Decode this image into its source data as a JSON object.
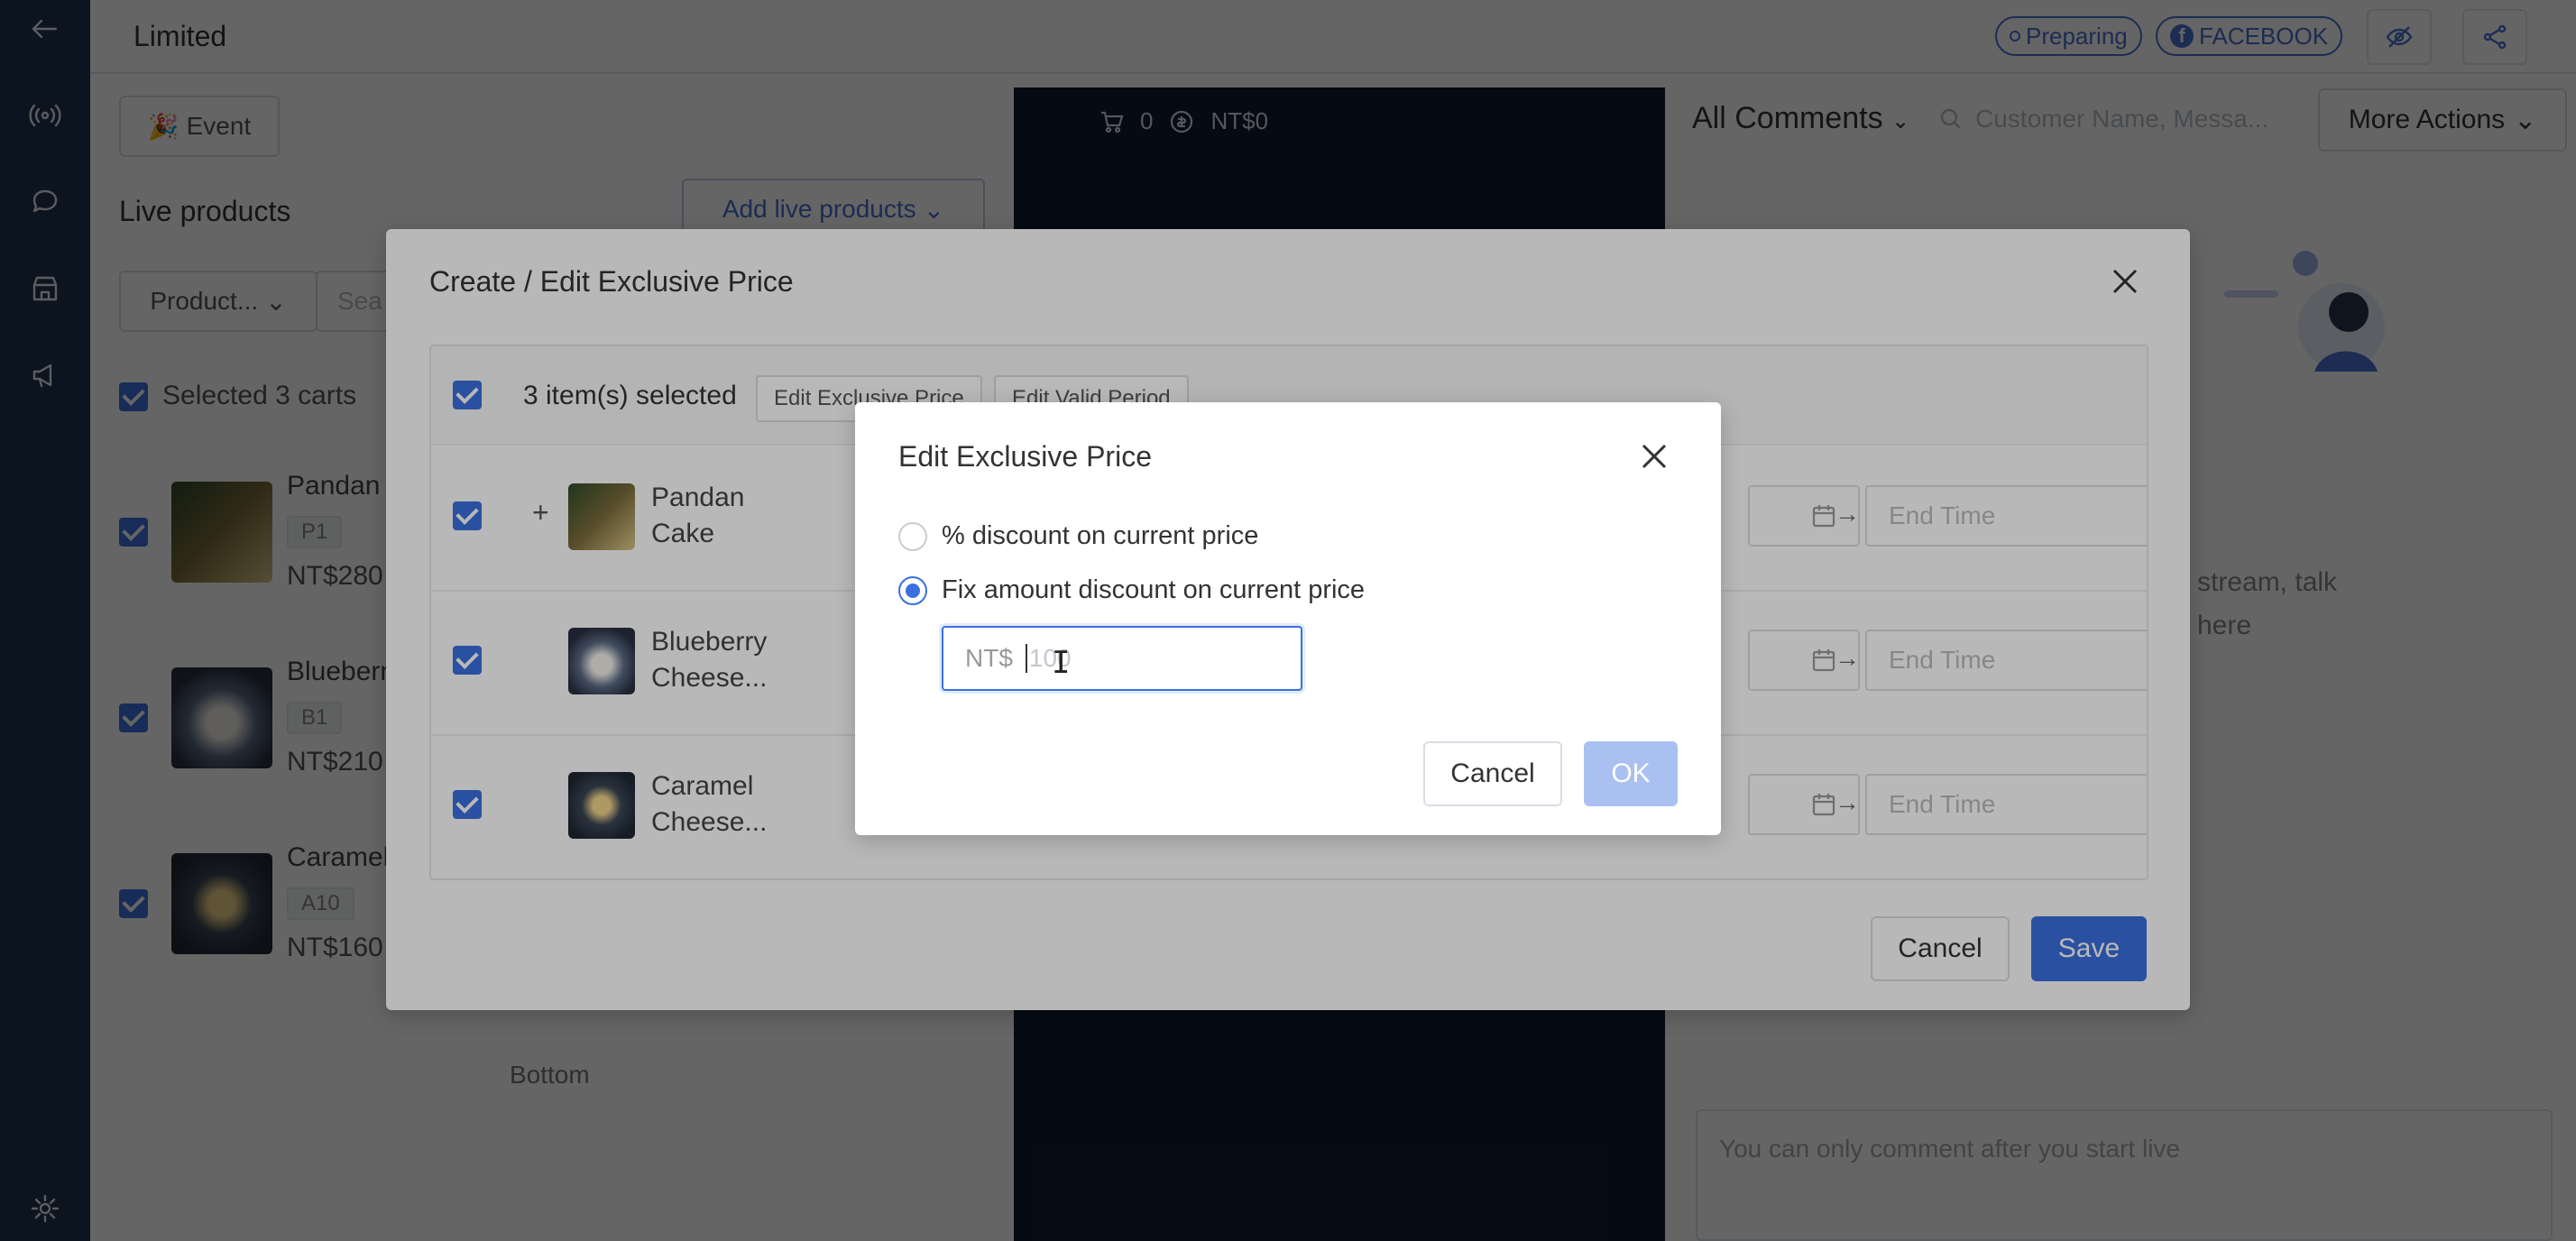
{
  "topbar": {
    "title": "Limited",
    "status_pill": "Preparing",
    "platform_pill": "FACEBOOK"
  },
  "sidebar": {
    "icons": [
      "back-arrow-icon",
      "broadcast-icon",
      "chat-icon",
      "store-icon",
      "megaphone-icon",
      "gear-icon"
    ]
  },
  "left_panel": {
    "event_button": "Event",
    "live_products_title": "Live products",
    "add_live_products": "Add live products",
    "product_filter": "Product...",
    "search_placeholder": "Sea",
    "selected_carts": "Selected 3 carts",
    "products": [
      {
        "name": "Pandan",
        "tag": "P1",
        "price": "NT$280"
      },
      {
        "name": "Bluebern",
        "tag": "B1",
        "price": "NT$210"
      },
      {
        "name": "Caramel",
        "tag": "A10",
        "price": "NT$160"
      }
    ],
    "bottom_text": "Bottom"
  },
  "stream": {
    "cart_count": "0",
    "amount": "NT$0"
  },
  "right_panel": {
    "comments_filter": "All Comments",
    "search_placeholder": "Customer Name, Messa...",
    "more_actions": "More Actions",
    "empty_line1": "stream, talk",
    "empty_line2": "here",
    "comment_placeholder": "You can only comment after you start live"
  },
  "exclusive_modal": {
    "title": "Create / Edit Exclusive Price",
    "selected_count": "3 item(s) selected",
    "edit_price_button": "Edit Exclusive Price",
    "edit_period_button": "Edit Valid Period",
    "rows": [
      {
        "name_line1": "Pandan",
        "name_line2": "Cake",
        "end_placeholder": "End Time"
      },
      {
        "name_line1": "Blueberry",
        "name_line2": "Cheese...",
        "end_placeholder": "End Time"
      },
      {
        "name_line1": "Caramel",
        "name_line2": "Cheese...",
        "end_placeholder": "End Time"
      }
    ],
    "cancel": "Cancel",
    "save": "Save"
  },
  "price_modal": {
    "title": "Edit Exclusive Price",
    "option_percent": "% discount on current price",
    "option_fixed": "Fix amount discount on current price",
    "selected_option": "fixed",
    "currency_prefix": "NT$",
    "amount_placeholder": "100",
    "cancel": "Cancel",
    "ok": "OK"
  },
  "colors": {
    "primary": "#3b6fe0",
    "sidebar": "#1f3350",
    "stream_bg": "#0e1c36"
  }
}
